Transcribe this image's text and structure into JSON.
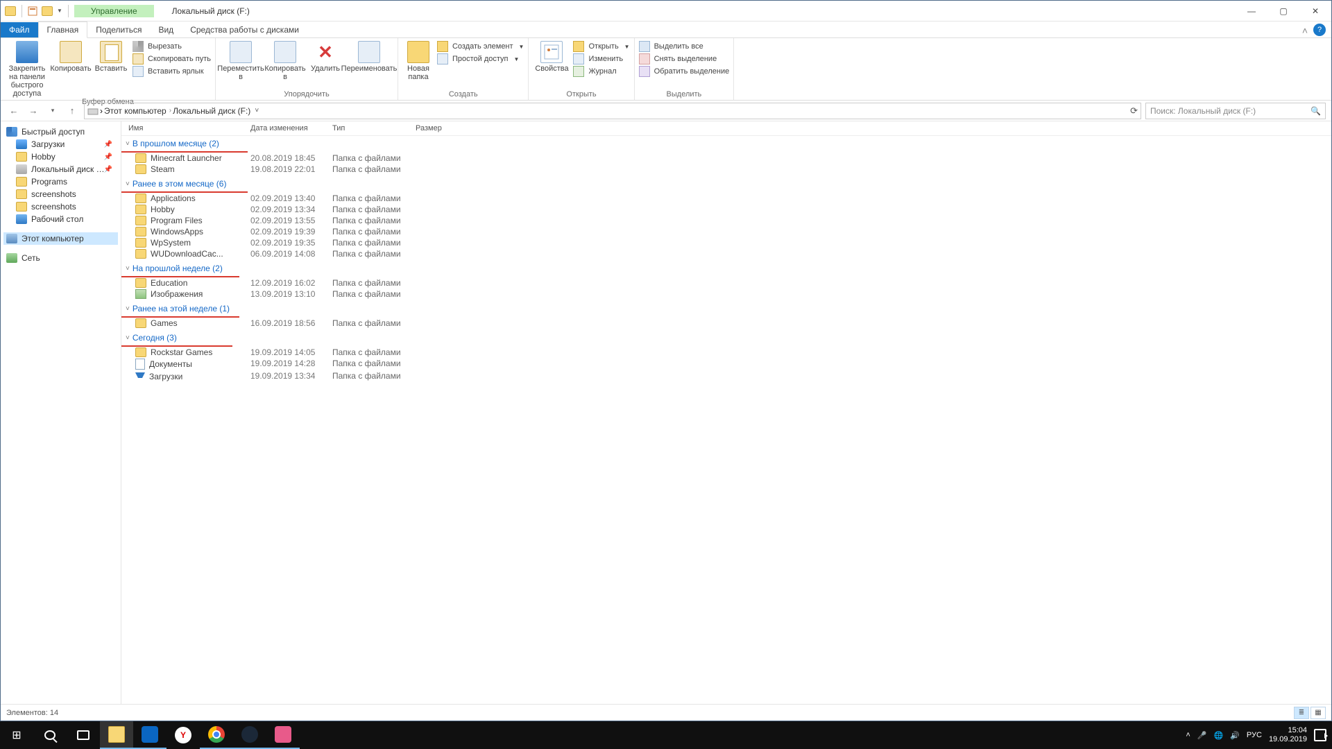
{
  "window": {
    "title": "Локальный диск (F:)",
    "context_tab": "Управление",
    "min": "—",
    "max": "▢",
    "close": "✕"
  },
  "tabs": {
    "file": "Файл",
    "home": "Главная",
    "share": "Поделиться",
    "view": "Вид",
    "drive": "Средства работы с дисками"
  },
  "ribbon": {
    "g_clipboard": "Буфер обмена",
    "pin": "Закрепить на панели быстрого доступа",
    "copy": "Копировать",
    "paste": "Вставить",
    "cut": "Вырезать",
    "copy_path": "Скопировать путь",
    "paste_shortcut": "Вставить ярлык",
    "g_organize": "Упорядочить",
    "move_to": "Переместить в",
    "copy_to": "Копировать в",
    "delete": "Удалить",
    "rename": "Переименовать",
    "g_new": "Создать",
    "new_folder": "Новая папка",
    "new_item": "Создать элемент",
    "easy_access": "Простой доступ",
    "g_open": "Открыть",
    "properties": "Свойства",
    "open": "Открыть",
    "edit": "Изменить",
    "history": "Журнал",
    "g_select": "Выделить",
    "select_all": "Выделить все",
    "select_none": "Снять выделение",
    "invert_sel": "Обратить выделение"
  },
  "path": {
    "c1": "Этот компьютер",
    "c2": "Локальный диск (F:)",
    "search_placeholder": "Поиск: Локальный диск (F:)"
  },
  "sidebar": {
    "quick": "Быстрый доступ",
    "downloads": "Загрузки",
    "hobby": "Hobby",
    "localf": "Локальный диск (F:)",
    "programs": "Programs",
    "screenshots1": "screenshots",
    "screenshots2": "screenshots",
    "desktop": "Рабочий стол",
    "this_pc": "Этот компьютер",
    "network": "Сеть"
  },
  "cols": {
    "name": "Имя",
    "date": "Дата изменения",
    "type": "Тип",
    "size": "Размер"
  },
  "groups": [
    {
      "title": "В прошлом месяце (2)",
      "uw": 182,
      "items": [
        {
          "icon": "folder",
          "name": "Minecraft Launcher",
          "date": "20.08.2019 18:45",
          "type": "Папка с файлами"
        },
        {
          "icon": "folder",
          "name": "Steam",
          "date": "19.08.2019 22:01",
          "type": "Папка с файлами"
        }
      ]
    },
    {
      "title": "Ранее в этом месяце (6)",
      "uw": 182,
      "items": [
        {
          "icon": "folder",
          "name": "Applications",
          "date": "02.09.2019 13:40",
          "type": "Папка с файлами"
        },
        {
          "icon": "folder",
          "name": "Hobby",
          "date": "02.09.2019 13:34",
          "type": "Папка с файлами"
        },
        {
          "icon": "folder",
          "name": "Program Files",
          "date": "02.09.2019 13:55",
          "type": "Папка с файлами"
        },
        {
          "icon": "folder",
          "name": "WindowsApps",
          "date": "02.09.2019 19:39",
          "type": "Папка с файлами"
        },
        {
          "icon": "folder",
          "name": "WpSystem",
          "date": "02.09.2019 19:35",
          "type": "Папка с файлами"
        },
        {
          "icon": "folder",
          "name": "WUDownloadCac...",
          "date": "06.09.2019 14:08",
          "type": "Папка с файлами"
        }
      ]
    },
    {
      "title": "На прошлой неделе (2)",
      "uw": 170,
      "items": [
        {
          "icon": "folder",
          "name": "Education",
          "date": "12.09.2019 16:02",
          "type": "Папка с файлами"
        },
        {
          "icon": "img",
          "name": "Изображения",
          "date": "13.09.2019 13:10",
          "type": "Папка с файлами"
        }
      ]
    },
    {
      "title": "Ранее на этой неделе (1)",
      "uw": 170,
      "items": [
        {
          "icon": "folder",
          "name": "Games",
          "date": "16.09.2019 18:56",
          "type": "Папка с файлами"
        }
      ]
    },
    {
      "title": "Сегодня (3)",
      "uw": 160,
      "items": [
        {
          "icon": "folder",
          "name": "Rockstar Games",
          "date": "19.09.2019 14:05",
          "type": "Папка с файлами"
        },
        {
          "icon": "doc",
          "name": "Документы",
          "date": "19.09.2019 14:28",
          "type": "Папка с файлами"
        },
        {
          "icon": "dl",
          "name": "Загрузки",
          "date": "19.09.2019 13:34",
          "type": "Папка с файлами"
        }
      ]
    }
  ],
  "status": {
    "items": "Элементов: 14"
  },
  "tray": {
    "lang": "РУС",
    "time": "15:04",
    "date": "19.09.2019",
    "chev": "˄"
  }
}
